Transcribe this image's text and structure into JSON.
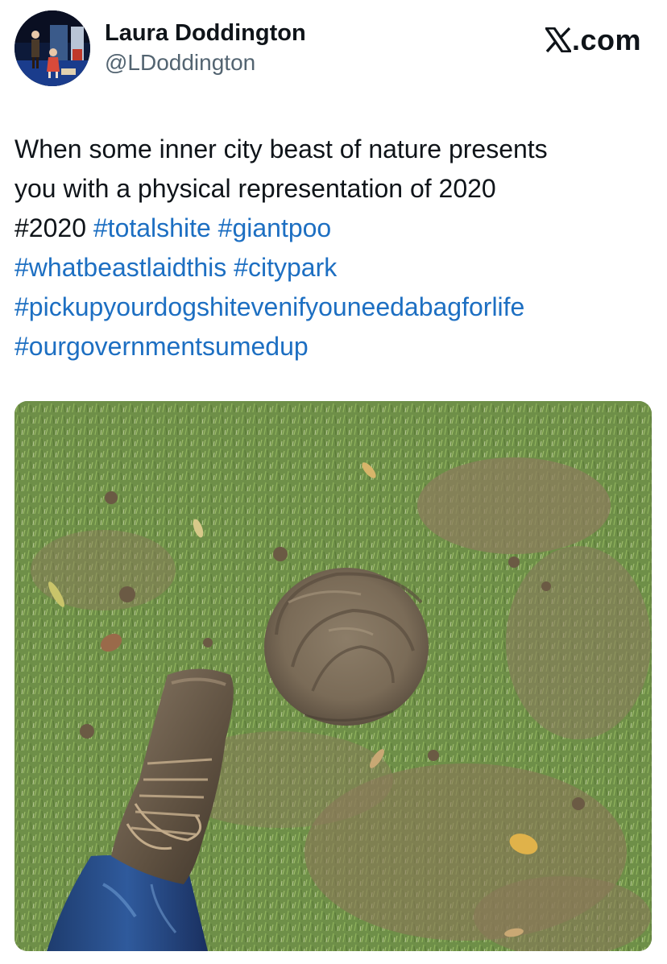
{
  "author": {
    "display_name": "Laura Doddington",
    "handle": "@LDoddington"
  },
  "brand": {
    "label": ".com",
    "logo_icon": "x-logo-icon"
  },
  "tweet": {
    "lines": [
      [
        {
          "text": "When some inner city beast of nature presents",
          "type": "text"
        }
      ],
      [
        {
          "text": "you with a physical representation of 2020",
          "type": "text"
        }
      ],
      [
        {
          "text": "#2020 ",
          "type": "text"
        },
        {
          "text": "#totalshite",
          "type": "hashtag"
        },
        {
          "text": " ",
          "type": "text"
        },
        {
          "text": "#giantpoo",
          "type": "hashtag"
        }
      ],
      [
        {
          "text": "#whatbeastlaidthis",
          "type": "hashtag"
        },
        {
          "text": " ",
          "type": "text"
        },
        {
          "text": "#citypark",
          "type": "hashtag"
        }
      ],
      [
        {
          "text": "#pickupyourdogshitevenifyouneedabagforlife",
          "type": "hashtag"
        }
      ],
      [
        {
          "text": "#ourgovernmentsumedup",
          "type": "hashtag"
        }
      ]
    ]
  },
  "colors": {
    "hashtag": "#1d6fc2",
    "text": "#0f1419",
    "secondary": "#536471"
  }
}
